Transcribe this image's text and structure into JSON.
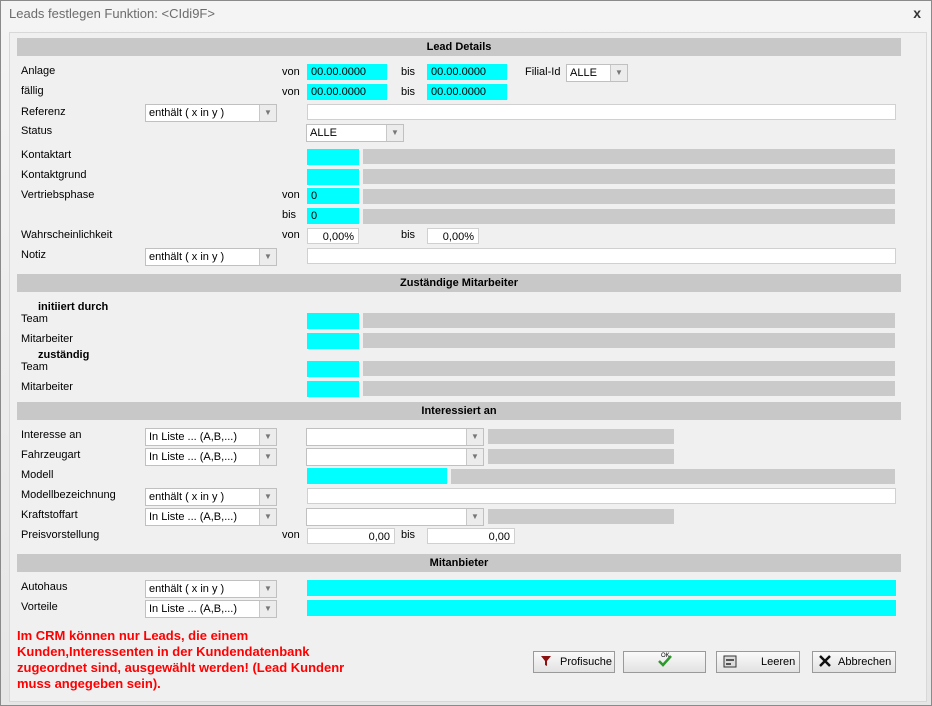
{
  "window": {
    "title": "Leads festlegen Funktion: <CIdi9F>",
    "close": "x"
  },
  "sections": {
    "lead_details": "Lead Details",
    "zustaendige": "Zuständige Mitarbeiter",
    "interessiert": "Interessiert an",
    "mitanbieter": "Mitanbieter"
  },
  "lead": {
    "anlage_label": "Anlage",
    "faellig_label": "fällig",
    "referenz_label": "Referenz",
    "status_label": "Status",
    "kontaktart_label": "Kontaktart",
    "kontaktgrund_label": "Kontaktgrund",
    "vertriebsphase_label": "Vertriebsphase",
    "wahrscheinlichkeit_label": "Wahrscheinlichkeit",
    "notiz_label": "Notiz",
    "von": "von",
    "bis": "bis",
    "filial_label": "Filial-Id",
    "filial_value": "ALLE",
    "anlage_von": "00.00.0000",
    "anlage_bis": "00.00.0000",
    "faellig_von": "00.00.0000",
    "faellig_bis": "00.00.0000",
    "referenz_op": "enthält ( x in y )",
    "status_value": "ALLE",
    "vertrieb_von": "0",
    "vertrieb_bis": "0",
    "wahr_von": "0,00%",
    "wahr_bis": "0,00%",
    "notiz_op": "enthält ( x in y )"
  },
  "mitarbeiter": {
    "initiiert": "initiiert durch",
    "zustaendig": "zuständig",
    "team_label": "Team",
    "mitarbeiter_label": "Mitarbeiter"
  },
  "interesse": {
    "interesse_label": "Interesse an",
    "fahrzeugart_label": "Fahrzeugart",
    "modell_label": "Modell",
    "modellbez_label": "Modellbezeichnung",
    "kraftstoff_label": "Kraftstoffart",
    "preis_label": "Preisvorstellung",
    "list_op": "In Liste ... (A,B,...)",
    "contains_op": "enthält ( x in y )",
    "von": "von",
    "bis": "bis",
    "preis_von": "0,00",
    "preis_bis": "0,00"
  },
  "mitanbieter": {
    "autohaus_label": "Autohaus",
    "vorteile_label": "Vorteile",
    "autohaus_op": "enthält ( x in y )",
    "vorteile_op": "In Liste ... (A,B,...)"
  },
  "warning": "Im CRM können nur Leads, die einem Kunden,Interessenten in der Kundendatenbank zugeordnet sind, ausgewählt werden! (Lead Kundenr muss angegeben sein).",
  "buttons": {
    "profisuche": "Profisuche",
    "ok": "OK",
    "leeren": "Leeren",
    "abbrechen": "Abbrechen"
  },
  "colors": {
    "field_accent": "#00ffff",
    "warning": "#ff0000",
    "section_bg": "#c8c8c8"
  }
}
